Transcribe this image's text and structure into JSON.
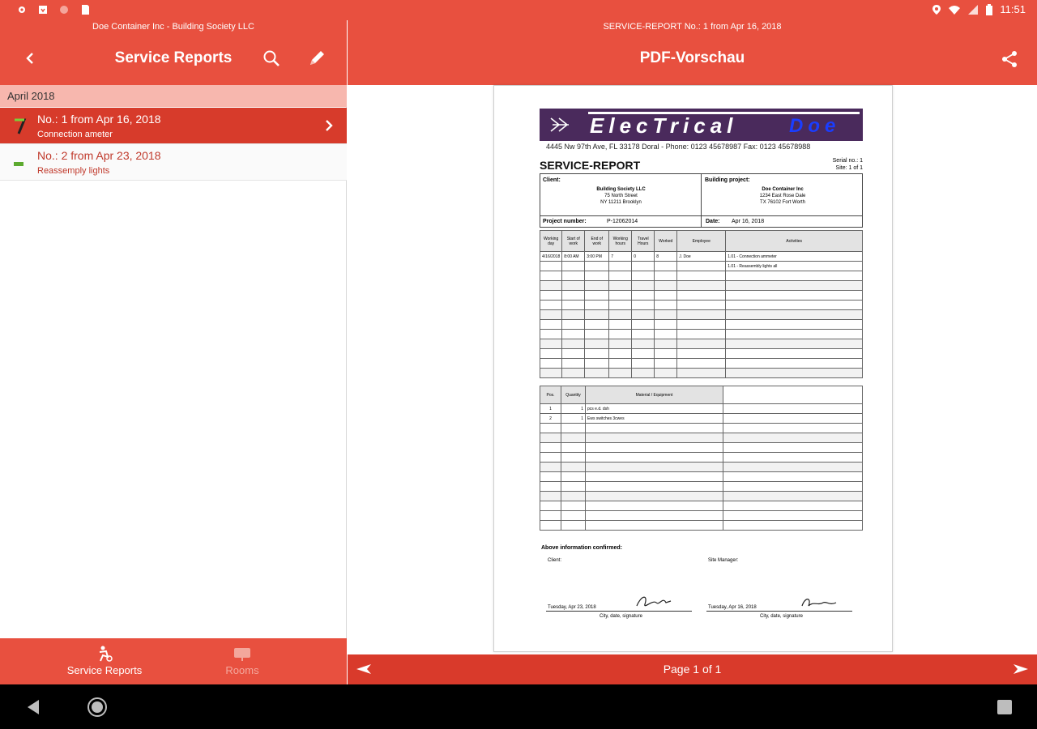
{
  "status_bar": {
    "time": "11:51",
    "left_icons": [
      "settings-icon",
      "download-icon",
      "sync-icon",
      "sd-card-icon"
    ],
    "right_icons": [
      "location-icon",
      "wifi-icon",
      "signal-icon",
      "battery-icon"
    ]
  },
  "left_pane": {
    "subtitle": "Doe Container Inc - Building Society LLC",
    "title": "Service Reports",
    "section_header": "April 2018",
    "rows": [
      {
        "title": "No.: 1 from Apr 16, 2018",
        "subtitle": "Connection ameter",
        "selected": true
      },
      {
        "title": "No.: 2 from Apr 23, 2018",
        "subtitle": "Reassemply lights",
        "selected": false
      }
    ],
    "bottom_nav": [
      {
        "label": "Service Reports",
        "icon": "service-report-icon",
        "active": true
      },
      {
        "label": "Rooms",
        "icon": "rooms-icon",
        "active": false
      }
    ]
  },
  "right_pane": {
    "subtitle": "SERVICE-REPORT No.: 1 from Apr 16, 2018",
    "title": "PDF-Vorschau",
    "page_indicator": "Page 1 of 1"
  },
  "document": {
    "brand_main": "ElecTrical",
    "brand_suffix": "Doe",
    "address": "4445 Nw 97th Ave, FL 33178 Doral - Phone: 0123 45678987 Fax: 0123 45678988",
    "title": "SERVICE-REPORT",
    "serial_label": "Serial no.: 1",
    "site_label": "Site: 1 of 1",
    "client_label": "Client:",
    "client_name": "Building Society LLC",
    "client_street": "75 North Street",
    "client_city": "NY 11211 Brooklyn",
    "project_label": "Building project:",
    "project_name": "Doe Container Inc",
    "project_street": "1234 East Rose Dale",
    "project_city": "TX 76102 Fort Worth",
    "project_number_label": "Project number:",
    "project_number": "P-12062014",
    "date_label": "Date:",
    "date": "Apr 16, 2018",
    "col_headers": [
      "Working day",
      "Start of work",
      "End of work",
      "Working hours",
      "Travel Hours",
      "Worked",
      "Employee",
      "Activities"
    ],
    "work_row": [
      "4/16/2018",
      "8:00 AM",
      "3:00 PM",
      "7",
      "0",
      "8",
      "J. Doe"
    ],
    "activities": [
      "1.01 - Connection ammeter",
      "1.01 - Reassembly lights all"
    ],
    "material_headers": [
      "Pos.",
      "Quantity",
      "Material / Equipment"
    ],
    "material_rows": [
      [
        "1",
        "1",
        "pcs   e.d. dsh"
      ],
      [
        "2",
        "1",
        "Ews   switches 3cwes"
      ]
    ],
    "confirm_label": "Above information confirmed:",
    "client_sig_label": "Client:",
    "manager_sig_label": "Site Manager:",
    "client_sig_date": "Tuesday, Apr 23, 2018",
    "manager_sig_date": "Tuesday, Apr 16, 2018",
    "sig_caption": "City, date, signature"
  }
}
